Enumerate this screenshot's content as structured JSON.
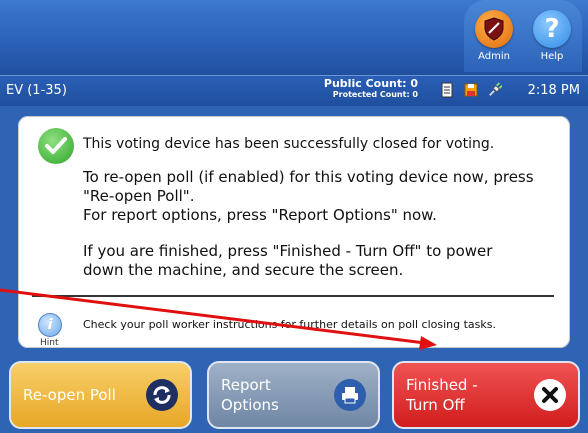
{
  "header": {
    "admin_label": "Admin",
    "help_label": "Help",
    "help_glyph": "?"
  },
  "status": {
    "precinct": "EV (1-35)",
    "public_count": "Public Count: 0",
    "protected_count": "Protected Count: 0",
    "time": "2:18 PM"
  },
  "message": {
    "title": "This voting device has been successfully closed for voting.",
    "line_reopen_1": "To re-open poll (if enabled) for this voting device now, press",
    "line_reopen_2": "\"Re-open Poll\".",
    "line_report": "For report options, press \"Report Options\" now.",
    "line_finish_1": "If you are finished, press \"Finished - Turn Off\" to power",
    "line_finish_2": "down the machine, and secure the screen."
  },
  "hint": {
    "glyph": "i",
    "label": "Hint",
    "text": "Check your poll worker instructions for further details on poll closing tasks."
  },
  "buttons": {
    "reopen": "Re-open Poll",
    "report_1": "Report",
    "report_2": "Options",
    "finish_1": "Finished -",
    "finish_2": "Turn Off"
  },
  "colors": {
    "background": "#2f63b4",
    "reopen": "#e7a725",
    "report": "#6f86a4",
    "finish": "#d11d1d",
    "annotation_arrow": "#e01010"
  },
  "icons": {
    "admin": "shield-icon",
    "help": "question-icon",
    "printer_status": "printer-status-icon",
    "save_status": "disk-icon",
    "power_status": "power-plug-icon",
    "success": "checkmark-icon",
    "hint": "info-icon",
    "reopen": "refresh-icon",
    "report": "printer-icon",
    "finish": "close-x-icon"
  }
}
